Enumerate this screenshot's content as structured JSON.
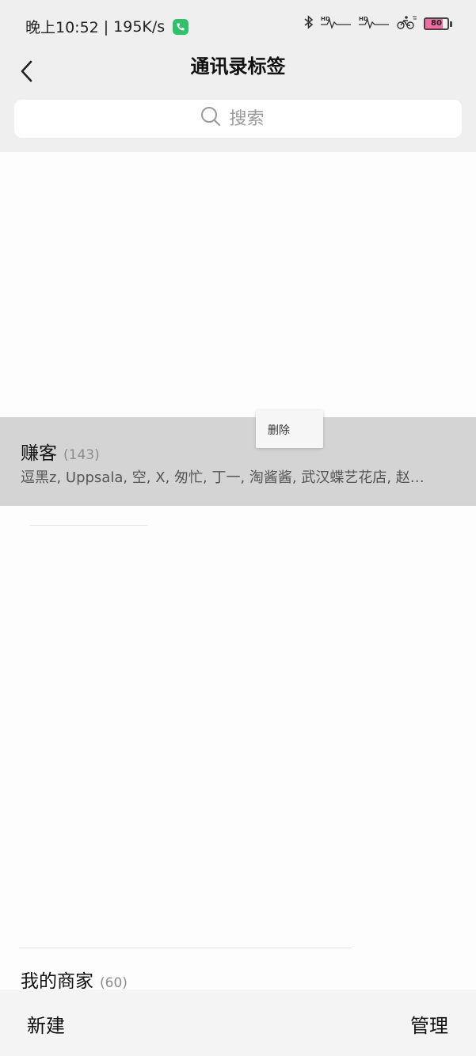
{
  "status_bar": {
    "time": "晚上10:52",
    "separator": "|",
    "net_speed": "195K/s",
    "battery": 80
  },
  "nav": {
    "title": "通讯录标签"
  },
  "search": {
    "placeholder": "搜索"
  },
  "tags": [
    {
      "name": "赚客",
      "count": "(143)",
      "members": "逗黑z, Uppsala, 空, X, 匆忙, 丁一, 淘酱酱, 武汉蝶艺花店, 赵…"
    },
    {
      "name": "我的商家",
      "count": "(60)"
    }
  ],
  "context_menu": {
    "delete_label": "删除"
  },
  "bottom_bar": {
    "new_label": "新建",
    "manage_label": "管理"
  },
  "colors": {
    "highlight_row": "#d4d4d4",
    "call_icon": "#2fc26a",
    "battery_fill": "#f06ea0"
  }
}
